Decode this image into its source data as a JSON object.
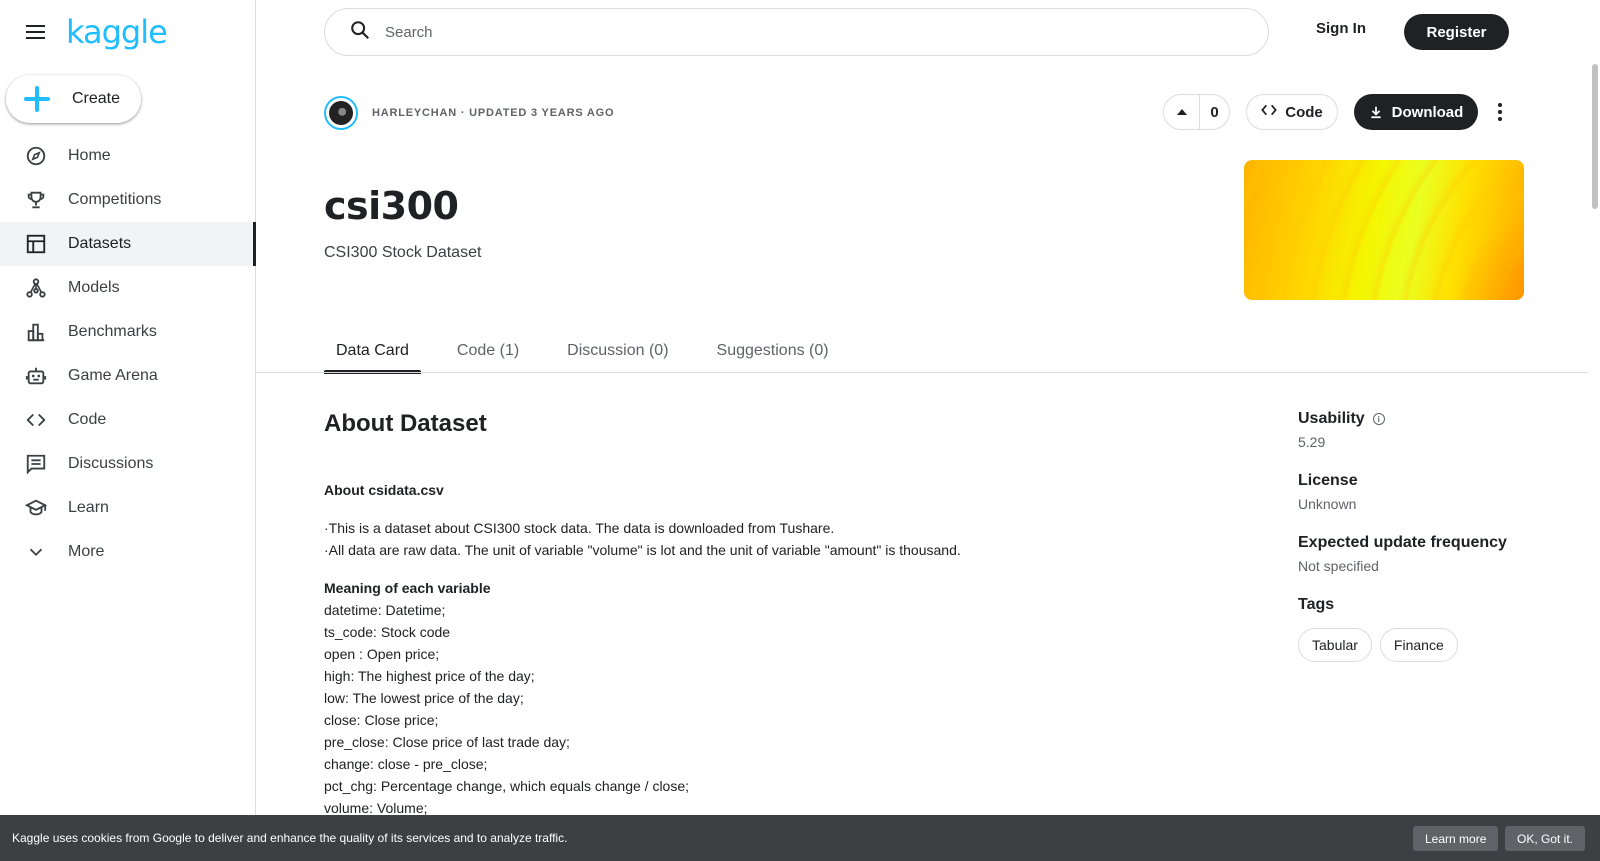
{
  "brand": {
    "logo_text": "kaggle",
    "accent": "#20beff"
  },
  "sidebar": {
    "create_label": "Create",
    "items": [
      {
        "label": "Home",
        "icon": "compass-icon"
      },
      {
        "label": "Competitions",
        "icon": "trophy-icon"
      },
      {
        "label": "Datasets",
        "icon": "table-icon",
        "active": true
      },
      {
        "label": "Models",
        "icon": "models-icon"
      },
      {
        "label": "Benchmarks",
        "icon": "bar-chart-icon"
      },
      {
        "label": "Game Arena",
        "icon": "robot-icon"
      },
      {
        "label": "Code",
        "icon": "code-icon"
      },
      {
        "label": "Discussions",
        "icon": "comment-icon"
      },
      {
        "label": "Learn",
        "icon": "graduation-cap-icon"
      },
      {
        "label": "More",
        "icon": "chevron-down-icon"
      }
    ]
  },
  "header": {
    "search_placeholder": "Search",
    "sign_in": "Sign In",
    "register": "Register"
  },
  "dataset": {
    "meta": "HARLEYCHAN · UPDATED 3 YEARS AGO",
    "votes": "0",
    "code_button": "Code",
    "download_button": "Download",
    "title": "csi300",
    "subtitle": "CSI300 Stock Dataset"
  },
  "tabs": [
    {
      "label": "Data Card",
      "active": true
    },
    {
      "label": "Code (1)"
    },
    {
      "label": "Discussion (0)"
    },
    {
      "label": "Suggestions (0)"
    }
  ],
  "about": {
    "title": "About Dataset",
    "file_heading": "About csidata.csv",
    "bullets": [
      "·This is a dataset about CSI300 stock data. The data is downloaded from Tushare.",
      "·All data are raw data. The unit of variable \"volume\" is lot and the unit of variable \"amount\" is thousand."
    ],
    "variables_heading": "Meaning of each variable",
    "variables": [
      "datetime: Datetime;",
      "ts_code: Stock code",
      "open : Open price;",
      "high: The highest price of the day;",
      "low: The lowest price of the day;",
      "close: Close price;",
      "pre_close: Close price of last trade day;",
      "change: close - pre_close;",
      "pct_chg: Percentage change, which equals change / close;",
      "volume: Volume;"
    ]
  },
  "side": {
    "usability_label": "Usability",
    "usability_value": "5.29",
    "license_label": "License",
    "license_value": "Unknown",
    "frequency_label": "Expected update frequency",
    "frequency_value": "Not specified",
    "tags_label": "Tags",
    "tags": [
      "Tabular",
      "Finance"
    ]
  },
  "cookie": {
    "text": "Kaggle uses cookies from Google to deliver and enhance the quality of its services and to analyze traffic.",
    "learn_more": "Learn more",
    "ok": "OK, Got it."
  }
}
